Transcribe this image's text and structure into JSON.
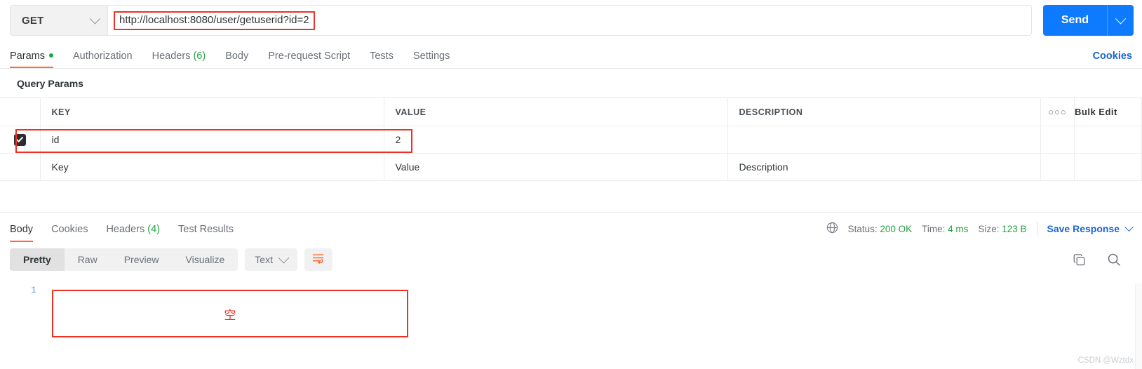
{
  "request": {
    "method": "GET",
    "url": "http://localhost:8080/user/getuserid?id=2",
    "send_label": "Send",
    "tabs": [
      {
        "label": "Params",
        "badge": "",
        "dot": true,
        "active": true
      },
      {
        "label": "Authorization",
        "badge": "",
        "dot": false,
        "active": false
      },
      {
        "label": "Headers",
        "badge": "(6)",
        "dot": false,
        "active": false
      },
      {
        "label": "Body",
        "badge": "",
        "dot": false,
        "active": false
      },
      {
        "label": "Pre-request Script",
        "badge": "",
        "dot": false,
        "active": false
      },
      {
        "label": "Tests",
        "badge": "",
        "dot": false,
        "active": false
      },
      {
        "label": "Settings",
        "badge": "",
        "dot": false,
        "active": false
      }
    ],
    "cookies_link": "Cookies"
  },
  "params": {
    "section_title": "Query Params",
    "columns": {
      "key": "KEY",
      "value": "VALUE",
      "description": "DESCRIPTION"
    },
    "dots_label": "○○○",
    "bulk_edit": "Bulk Edit",
    "rows": [
      {
        "checked": true,
        "key": "id",
        "value": "2",
        "description": ""
      }
    ],
    "placeholders": {
      "key": "Key",
      "value": "Value",
      "description": "Description"
    }
  },
  "response": {
    "tabs": [
      {
        "label": "Body",
        "badge": "",
        "active": true
      },
      {
        "label": "Cookies",
        "badge": "",
        "active": false
      },
      {
        "label": "Headers",
        "badge": "(4)",
        "active": false
      },
      {
        "label": "Test Results",
        "badge": "",
        "active": false
      }
    ],
    "status_label": "Status:",
    "status_value": "200 OK",
    "time_label": "Time:",
    "time_value": "4 ms",
    "size_label": "Size:",
    "size_value": "123 B",
    "save_label": "Save Response",
    "view_modes": [
      "Pretty",
      "Raw",
      "Preview",
      "Visualize"
    ],
    "active_view_mode": "Pretty",
    "format": "Text",
    "line_number": "1",
    "body_text": "",
    "annotation": "空"
  },
  "watermark": "CSDN @Wztdx",
  "colors": {
    "accent_orange": "#ff6c37",
    "send_blue": "#0e7afe",
    "link_blue": "#1b65d6",
    "status_green": "#25a244",
    "highlight_red": "#ee3124"
  }
}
